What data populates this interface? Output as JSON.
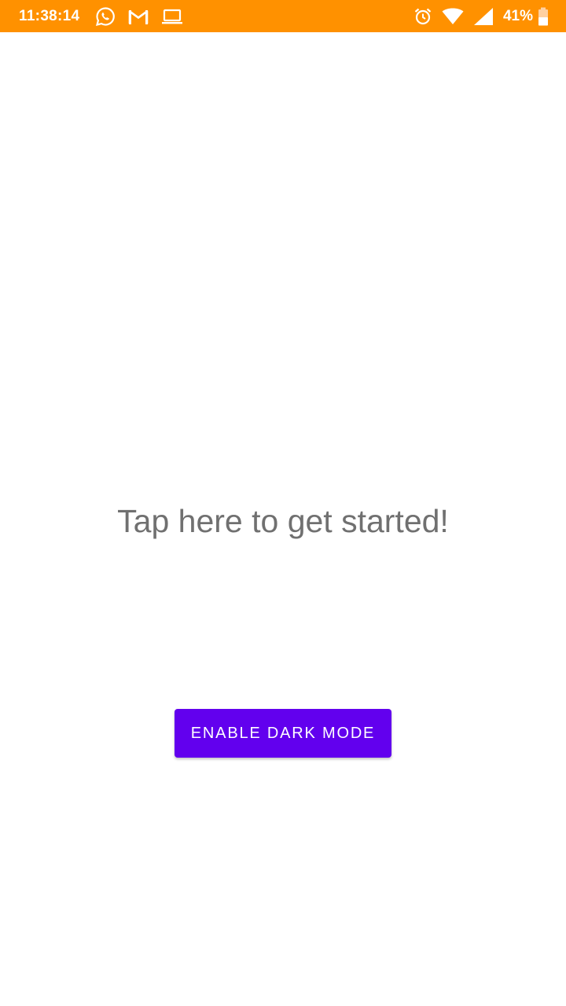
{
  "status_bar": {
    "time": "11:38:14",
    "battery_percent": "41%",
    "background_color": "#ff9100",
    "left_icons": [
      "whatsapp-icon",
      "gmail-icon",
      "laptop-icon"
    ],
    "right_icons": [
      "alarm-icon",
      "wifi-icon",
      "cellular-signal-icon",
      "battery-icon"
    ]
  },
  "main": {
    "prompt_text": "Tap here to get started!",
    "dark_mode_button_label": "ENABLE DARK MODE",
    "button_color": "#6200ee",
    "text_color": "#707070"
  }
}
